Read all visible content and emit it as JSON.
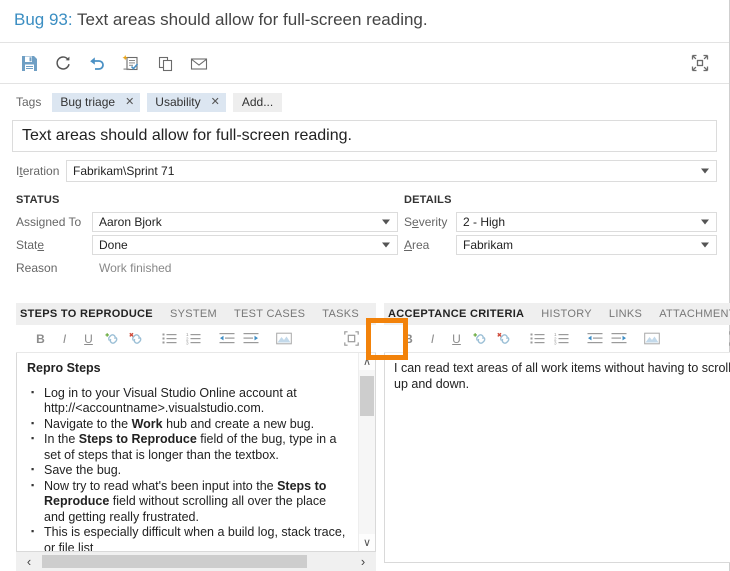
{
  "header": {
    "work_item_id": "Bug 93:",
    "work_item_title": "Text areas should allow for full-screen reading."
  },
  "toolbar": {
    "buttons": [
      {
        "name": "save",
        "icon": "save-icon",
        "label": "Save"
      },
      {
        "name": "refresh",
        "icon": "refresh-icon",
        "label": "Refresh"
      },
      {
        "name": "undo",
        "icon": "undo-icon",
        "label": "Undo"
      },
      {
        "name": "new-linked-work-item",
        "icon": "new-linked-item-icon",
        "label": "New Linked Work Item"
      },
      {
        "name": "copy",
        "icon": "copy-icon",
        "label": "Copy"
      },
      {
        "name": "email",
        "icon": "email-icon",
        "label": "Email"
      }
    ],
    "right_button": {
      "name": "restore-down",
      "icon": "restore-down-icon",
      "label": "Restore Down"
    }
  },
  "tags": {
    "label": "Tags",
    "items": [
      {
        "text": "Bug triage",
        "remove": "✕"
      },
      {
        "text": "Usability",
        "remove": "✕"
      }
    ],
    "add_label": "Add..."
  },
  "title_field": {
    "value": "Text areas should allow for full-screen reading."
  },
  "iteration": {
    "label_pre": "I",
    "label_accel": "t",
    "label_post": "eration",
    "value": "Fabrikam\\Sprint 71"
  },
  "status": {
    "heading": "STATUS",
    "fields": [
      {
        "label_pre": "Assi",
        "label_accel": "g",
        "label_post": "ned To",
        "value": "Aaron Bjork",
        "type": "combo"
      },
      {
        "label_pre": "Stat",
        "label_accel": "e",
        "label_post": "",
        "value": "Done",
        "type": "combo"
      },
      {
        "label_pre": "Reason",
        "label_accel": "",
        "label_post": "",
        "value": "Work finished",
        "type": "readonly"
      }
    ]
  },
  "details": {
    "heading": "DETAILS",
    "fields": [
      {
        "label_pre": "S",
        "label_accel": "e",
        "label_post": "verity",
        "value": "2 - High",
        "type": "combo"
      },
      {
        "label_pre": "",
        "label_accel": "A",
        "label_post": "rea",
        "value": "Fabrikam",
        "type": "combo"
      }
    ]
  },
  "left_panel": {
    "tabs": [
      {
        "label": "STEPS TO REPRODUCE",
        "active": true
      },
      {
        "label": "SYSTEM",
        "active": false
      },
      {
        "label": "TEST CASES",
        "active": false
      },
      {
        "label": "TASKS",
        "active": false
      }
    ],
    "editor_toolbar": [
      "bold",
      "italic",
      "underline",
      "insert-link",
      "remove-link",
      "bullet-list",
      "numbered-list",
      "outdent",
      "indent",
      "insert-image",
      "maximize"
    ],
    "content": {
      "heading": "Repro Steps",
      "bullets": [
        {
          "segments": [
            {
              "t": "Log in to your Visual Studio Online account at http://<accountname>.visualstudio.com.",
              "b": false
            }
          ]
        },
        {
          "segments": [
            {
              "t": "Navigate to the ",
              "b": false
            },
            {
              "t": "Work",
              "b": true
            },
            {
              "t": " hub and create a new bug.",
              "b": false
            }
          ]
        },
        {
          "segments": [
            {
              "t": "In the ",
              "b": false
            },
            {
              "t": "Steps to Reproduce",
              "b": true
            },
            {
              "t": " field of the bug, type in a set of steps that is longer than the textbox.",
              "b": false
            }
          ]
        },
        {
          "segments": [
            {
              "t": "Save the bug.",
              "b": false
            }
          ]
        },
        {
          "segments": [
            {
              "t": "Now try to read what's been input into the ",
              "b": false
            },
            {
              "t": "Steps to Reproduce",
              "b": true
            },
            {
              "t": " field without scrolling all over the place and getting really frustrated.",
              "b": false
            }
          ]
        },
        {
          "segments": [
            {
              "t": "This is especially difficult when a build log, stack trace, or file list",
              "b": false
            }
          ]
        }
      ]
    },
    "scroll": {
      "up": "∧",
      "down": "∨",
      "left": "‹",
      "right": "›"
    }
  },
  "right_panel": {
    "tabs": [
      {
        "label": "ACCEPTANCE CRITERIA",
        "active": true
      },
      {
        "label": "HISTORY",
        "active": false
      },
      {
        "label": "LINKS",
        "active": false
      },
      {
        "label": "ATTACHMENT",
        "active": false
      }
    ],
    "editor_toolbar": [
      "bold",
      "italic",
      "underline",
      "insert-link",
      "remove-link",
      "bullet-list",
      "numbered-list",
      "outdent",
      "indent",
      "insert-image",
      "maximize"
    ],
    "content": "I can read text areas of all work items without having to scroll up and down."
  },
  "annotation": {
    "color": "#f2820a",
    "target": "maximize-button"
  },
  "colors": {
    "accent_link": "#3b8ec2",
    "tag_bg": "#dce6f1",
    "tab_bar_bg": "#efefef",
    "highlight": "#f2820a",
    "toolbar_blue": "#4a90c4"
  }
}
